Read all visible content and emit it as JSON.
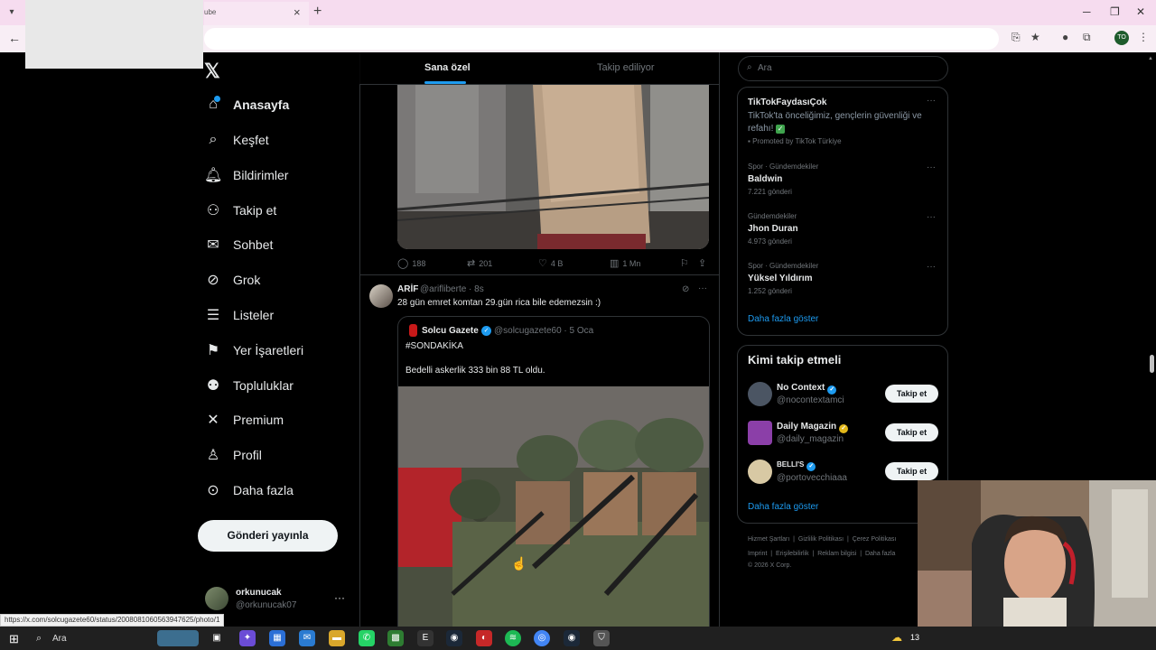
{
  "browser": {
    "tab_title": "ube",
    "tab_close": "×",
    "new_tab": "+",
    "profile_initials": "TO",
    "status_url": "https://x.com/solcugazete60/status/2008081060563947625/photo/1"
  },
  "nav": {
    "logo": "𝕏",
    "items": [
      {
        "label": "Anasayfa",
        "icon": "home-icon"
      },
      {
        "label": "Keşfet",
        "icon": "search-icon"
      },
      {
        "label": "Bildirimler",
        "icon": "bell-icon"
      },
      {
        "label": "Takip et",
        "icon": "add-user-icon"
      },
      {
        "label": "Sohbet",
        "icon": "mail-icon"
      },
      {
        "label": "Grok",
        "icon": "grok-icon"
      },
      {
        "label": "Listeler",
        "icon": "list-icon"
      },
      {
        "label": "Yer İşaretleri",
        "icon": "bookmark-icon"
      },
      {
        "label": "Topluluklar",
        "icon": "communities-icon"
      },
      {
        "label": "Premium",
        "icon": "x-icon"
      },
      {
        "label": "Profil",
        "icon": "profile-icon"
      },
      {
        "label": "Daha fazla",
        "icon": "more-circle-icon"
      }
    ],
    "post_button": "Gönderi yayınla",
    "user": {
      "name": "orkunucak",
      "handle": "@orkunucak07",
      "more": "···"
    }
  },
  "timeline": {
    "tabs": {
      "for_you": "Sana özel",
      "following": "Takip ediliyor"
    },
    "tweet1_actions": {
      "replies": "188",
      "reposts": "201",
      "likes": "4 B",
      "views": "1 Mn"
    },
    "tweet2": {
      "name": "ARİF",
      "handle": "@arifliberte · 8s",
      "text": "28 gün emret komtan 29.gün rica bile edemezsin :)",
      "quote": {
        "name": "Solcu Gazete",
        "handle": "@solcugazete60 · 5 Oca",
        "line1": "#SONDAKİKA",
        "line2": "Bedelli askerlik 333 bin 88 TL oldu."
      }
    }
  },
  "sidebar": {
    "search_placeholder": "Ara",
    "promo": {
      "title": "TikTokFaydasıÇok",
      "text": "TikTok'ta önceliğimiz, gençlerin güvenliği ve refahı!",
      "by": "Promoted by TikTok Türkiye"
    },
    "trends": [
      {
        "context": "Spor · Gündemdekiler",
        "title": "Baldwin",
        "count": "7.221 gönderi"
      },
      {
        "context": "Gündemdekiler",
        "title": "Jhon Duran",
        "count": "4.973 gönderi"
      },
      {
        "context": "Spor · Gündemdekiler",
        "title": "Yüksel Yıldırım",
        "count": "1.252 gönderi"
      }
    ],
    "show_more": "Daha fazla göster",
    "who_to_follow": {
      "title": "Kimi takip etmeli",
      "button": "Takip et",
      "users": [
        {
          "name": "No Context",
          "handle": "@nocontextamci"
        },
        {
          "name": "Daily Magazin",
          "handle": "@daily_magazin"
        },
        {
          "name": "BELLI'S",
          "handle": "@portovecchiaaa"
        }
      ],
      "show_more": "Daha fazla göster"
    },
    "footer": {
      "row1": [
        "Hizmet Şartları",
        "Gizlilik Politikası",
        "Çerez Politikası"
      ],
      "row2": [
        "Imprint",
        "Erişilebilirlik",
        "Reklam bilgisi",
        "Daha fazla"
      ],
      "copyright": "© 2026 X Corp."
    }
  },
  "taskbar": {
    "search": "Ara",
    "time": "13"
  }
}
